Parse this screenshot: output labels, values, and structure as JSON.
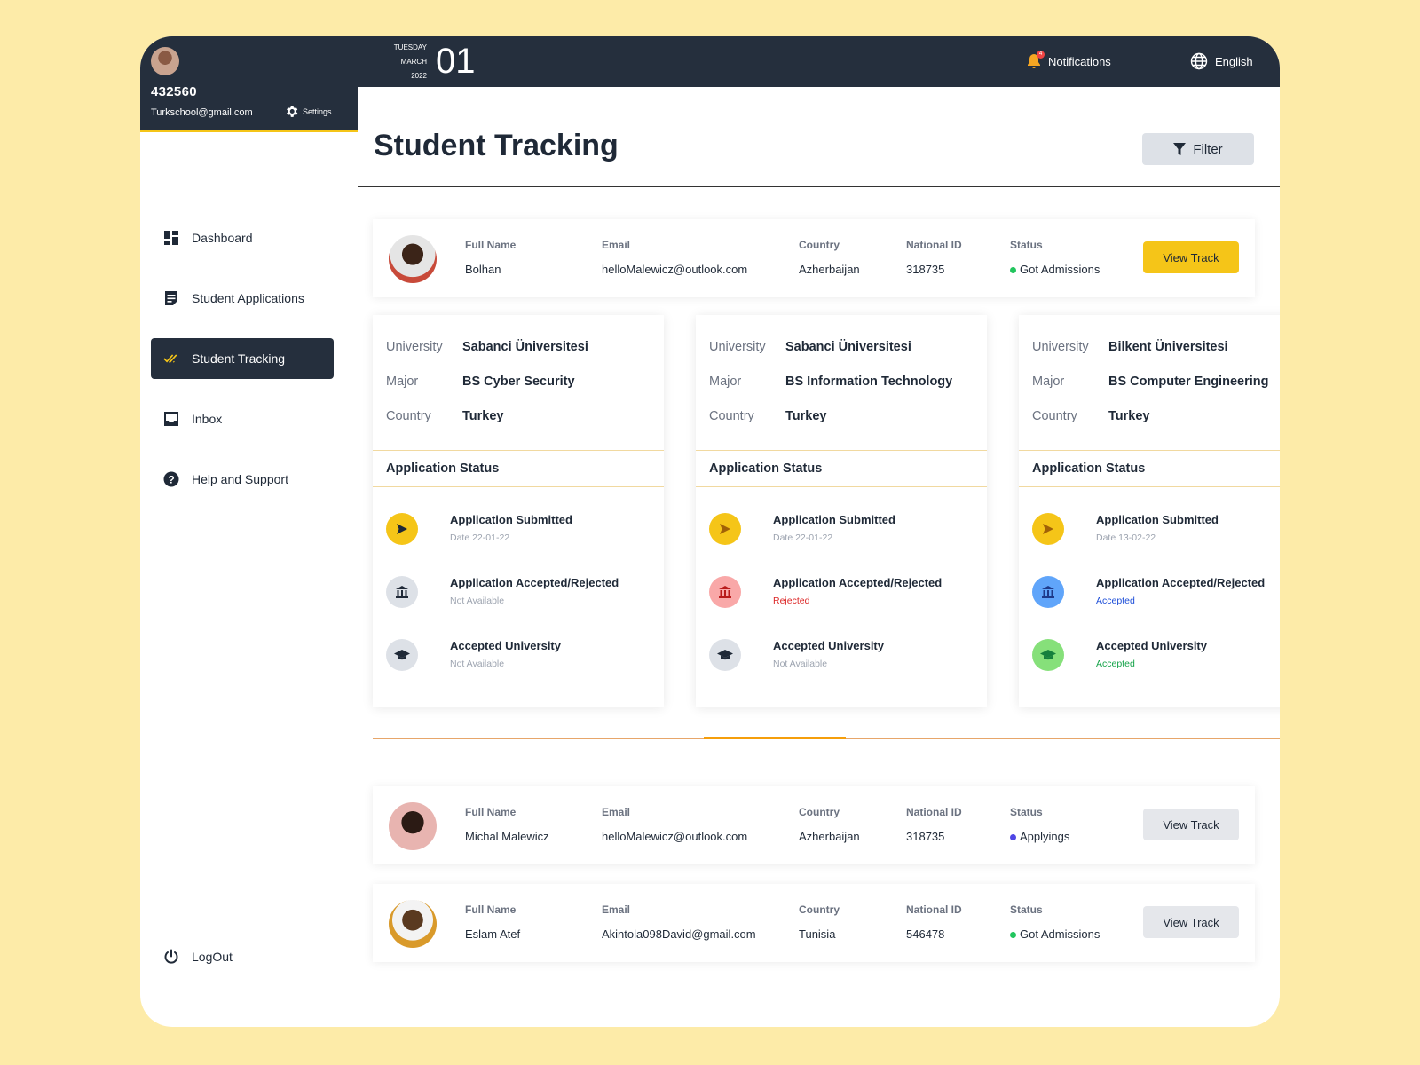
{
  "profile": {
    "user_id": "432560",
    "email": "Turkschool@gmail.com",
    "settings_label": "Settings"
  },
  "topbar": {
    "day_name": "TUESDAY",
    "month": "MARCH",
    "year": "2022",
    "day": "01",
    "notifications_label": "Notifications",
    "notifications_count": "4",
    "language_label": "English"
  },
  "nav": {
    "items": [
      {
        "label": "Dashboard",
        "icon": "dashboard-icon"
      },
      {
        "label": "Student Applications",
        "icon": "applications-icon"
      },
      {
        "label": "Student Tracking",
        "icon": "double-check-icon"
      },
      {
        "label": "Inbox",
        "icon": "inbox-icon"
      },
      {
        "label": "Help and Support",
        "icon": "help-icon"
      }
    ],
    "logout_label": "LogOut"
  },
  "page": {
    "title": "Student Tracking",
    "filter_label": "Filter"
  },
  "labels": {
    "full_name": "Full Name",
    "email": "Email",
    "country": "Country",
    "national_id": "National ID",
    "status": "Status",
    "view_track": "View Track"
  },
  "students": [
    {
      "full_name": "Bolhan",
      "email": "helloMalewicz@outlook.com",
      "country": "Azherbaijan",
      "national_id": "318735",
      "status": "Got Admissions",
      "status_color": "#22c55e"
    },
    {
      "full_name": "Michal Malewicz",
      "email": "helloMalewicz@outlook.com",
      "country": "Azherbaijan",
      "national_id": "318735",
      "status": "Applyings",
      "status_color": "#4f46e5"
    },
    {
      "full_name": "Eslam Atef",
      "email": "Akintola098David@gmail.com",
      "country": "Tunisia",
      "national_id": "546478",
      "status": "Got Admissions",
      "status_color": "#22c55e"
    }
  ],
  "card_labels": {
    "university": "University",
    "major": "Major",
    "country": "Country",
    "application_status": "Application Status"
  },
  "step_titles": {
    "submitted": "Application Submitted",
    "decision": "Application Accepted/Rejected",
    "accepted": "Accepted University"
  },
  "applications": [
    {
      "university": "Sabanci Üniversitesi",
      "major": "BS Cyber Security",
      "country": "Turkey",
      "submitted": "Date 22-01-22",
      "decision": "Not Available",
      "accepted_uni": "Not Available"
    },
    {
      "university": "Sabanci Üniversitesi",
      "major": "BS Information Technology",
      "country": "Turkey",
      "submitted": "Date 22-01-22",
      "decision": "Rejected",
      "accepted_uni": "Not Available"
    },
    {
      "university": "Bilkent Üniversitesi",
      "major": "BS Computer Engineering",
      "country": "Turkey",
      "submitted": "Date 13-02-22",
      "decision": "Accepted",
      "accepted_uni": "Accepted"
    }
  ],
  "colors": {
    "accent": "#F5C518",
    "dark": "#252f3d",
    "rejected": "#dc2626",
    "accepted_blue": "#1d4ed8",
    "accepted_green": "#16a34a"
  }
}
